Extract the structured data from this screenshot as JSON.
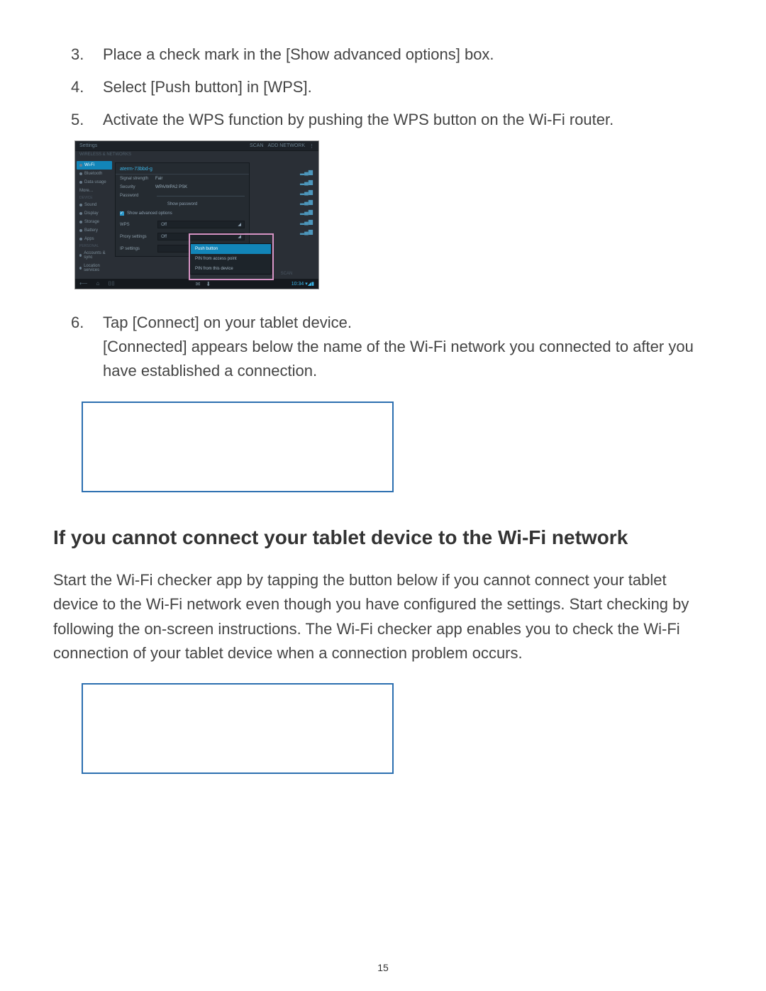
{
  "steps": {
    "s3": {
      "num": "3.",
      "text": "Place a check mark in the [Show advanced options] box."
    },
    "s4": {
      "num": "4.",
      "text": "Select [Push button] in [WPS]."
    },
    "s5": {
      "num": "5.",
      "text": "Activate the WPS function by pushing the WPS button on the Wi-Fi router."
    },
    "s6": {
      "num": "6.",
      "text": "Tap [Connect] on your tablet device.",
      "sub": "[Connected] appears below the name of the Wi-Fi network you connected to after you have established a connection."
    }
  },
  "screenshot": {
    "title": "Settings",
    "header_right1": "SCAN",
    "header_right2": "ADD NETWORK",
    "header_menu": "⋮",
    "subtitle": "WIRELESS & NETWORKS",
    "sidebar": {
      "wifi": "Wi-Fi",
      "bluetooth": "Bluetooth",
      "data": "Data usage",
      "more": "More…",
      "section_device": "DEVICE",
      "sound": "Sound",
      "display": "Display",
      "storage": "Storage",
      "battery": "Battery",
      "apps": "Apps",
      "section_personal": "PERSONAL",
      "accounts": "Accounts & sync",
      "location": "Location services"
    },
    "dialog": {
      "ssid": "aterm-73bbd-g",
      "signal_label": "Signal strength",
      "signal_val": "Fair",
      "security_label": "Security",
      "security_val": "WPA/WPA2 PSK",
      "password_label": "Password",
      "show_password": "Show password",
      "show_advanced": "Show advanced options",
      "wps_label": "WPS",
      "wps_val": "Off",
      "proxy_label": "Proxy settings",
      "proxy_val": "Off",
      "ip_label": "IP settings",
      "caret": "◢"
    },
    "dropdown": {
      "opt1": "Push button",
      "opt2": "PIN from access point",
      "opt3": "PIN from this device"
    },
    "rightpane": {
      "scan": "SCAN"
    },
    "wifi_signal": "▂▄▆",
    "nav": {
      "back": "⟵",
      "home": "⌂",
      "recent": "⌷⌷",
      "icon1": "✉",
      "icon2": "⬇",
      "time": "10:34 ▾◢▮"
    }
  },
  "heading": "If you cannot connect your tablet device to the Wi-Fi network",
  "paragraph": "Start the Wi-Fi checker app by tapping the button below if you cannot connect your tablet device to the Wi-Fi network even though you have configured the settings. Start checking by following the on-screen instructions. The Wi-Fi checker app enables you to check the Wi-Fi connection of your tablet device when a connection problem occurs.",
  "page_number": "15"
}
